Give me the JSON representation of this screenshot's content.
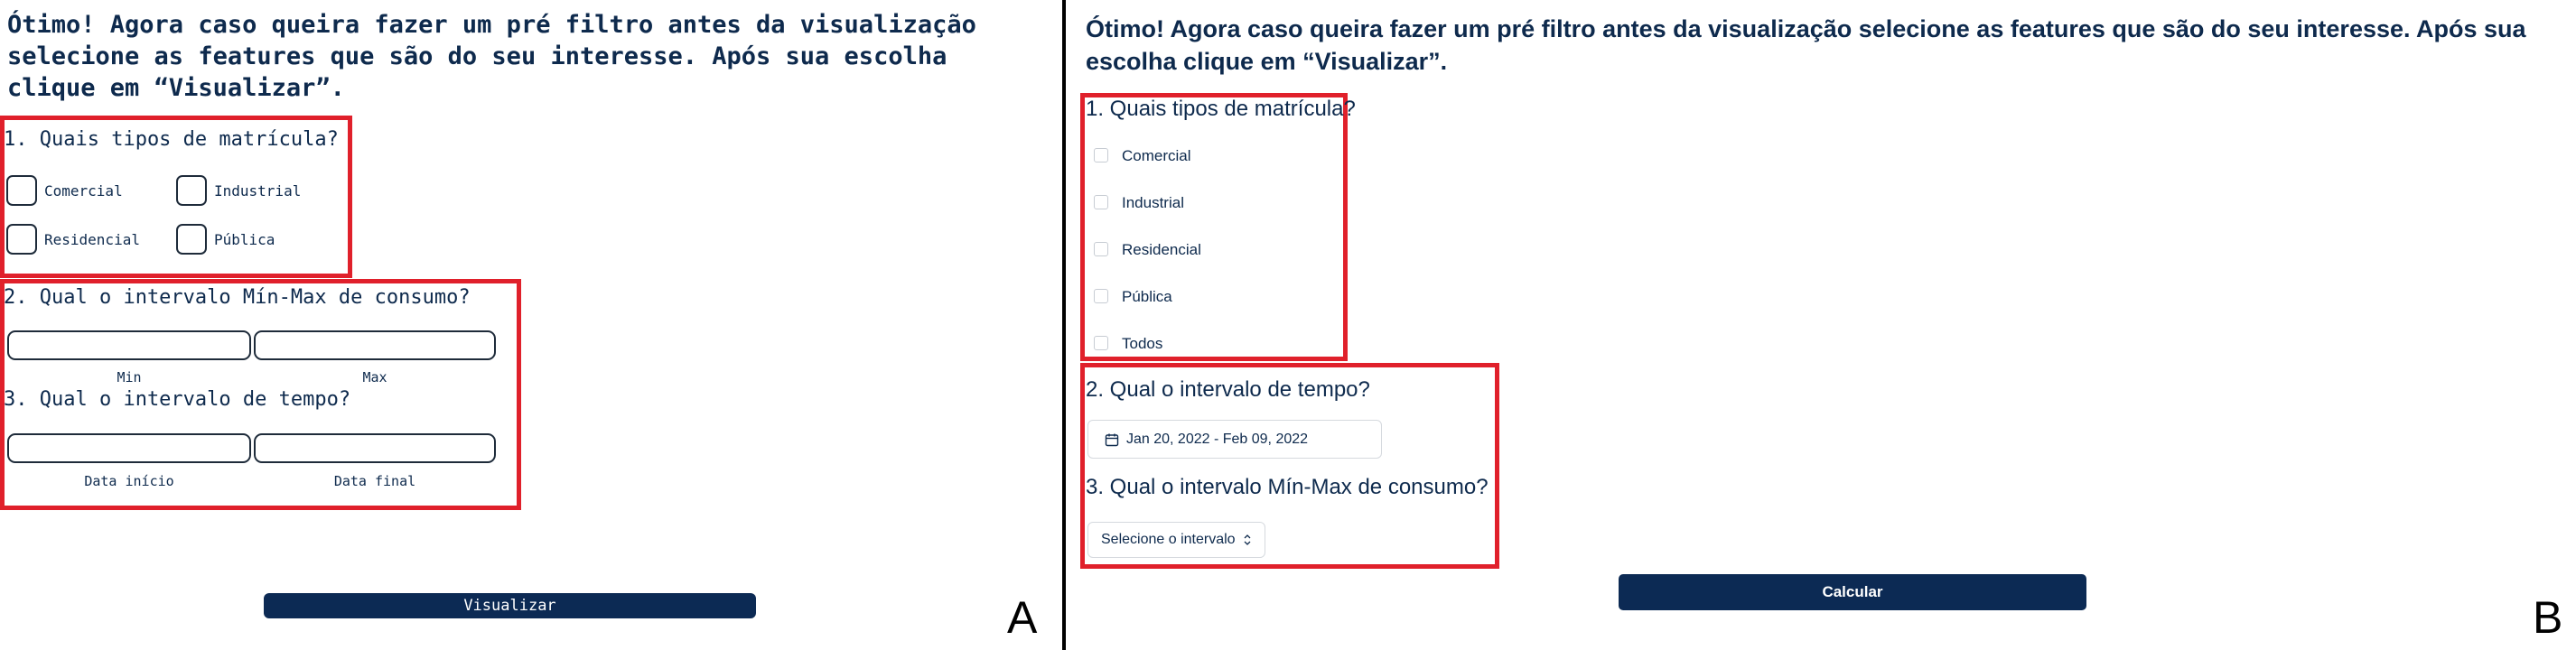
{
  "panel_a": {
    "intro": "Ótimo! Agora caso queira fazer um pré filtro antes da visualização selecione as features que são do seu interesse. Após sua escolha clique em “Visualizar”.",
    "q1": "1. Quais tipos de matrícula?",
    "checkboxes": [
      "Comercial",
      "Industrial",
      "Residencial",
      "Pública"
    ],
    "q2": "2. Qual o intervalo Mín-Max de consumo?",
    "min_label": "Min",
    "max_label": "Max",
    "q3": "3. Qual o intervalo de tempo?",
    "start_label": "Data início",
    "end_label": "Data final",
    "button": "Visualizar",
    "letter": "A"
  },
  "panel_b": {
    "intro": "Ótimo! Agora caso queira fazer um pré filtro antes da visualização selecione as features que são do seu interesse. Após sua escolha clique em “Visualizar”.",
    "q1": "1. Quais tipos de matrícula?",
    "checkboxes": [
      "Comercial",
      "Industrial",
      "Residencial",
      "Pública",
      "Todos"
    ],
    "q2": "2. Qual o intervalo de tempo?",
    "date_range": "Jan 20, 2022 - Feb 09, 2022",
    "q3": "3. Qual o intervalo Mín-Max de consumo?",
    "select_value": "Selecione o intervalo",
    "button": "Calcular",
    "letter": "B"
  },
  "colors": {
    "navy": "#0c2a54",
    "text": "#0e2a4d",
    "highlight_red": "#e0202b"
  },
  "icons": [
    "calendar-icon",
    "chevron-updown-icon"
  ]
}
